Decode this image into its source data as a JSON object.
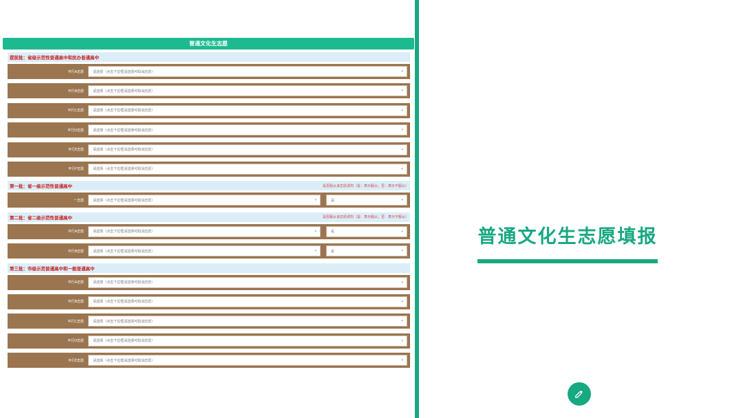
{
  "form": {
    "header": "普通文化生志愿",
    "placeholder": "请选择（点击下拉框请选择可取消志愿）",
    "yes_value": "是",
    "sections": [
      {
        "title": "提前批：省级示范性普通高中和民办普通高中",
        "note": "",
        "rows": [
          {
            "label": "平行A志愿",
            "has_yn": false
          },
          {
            "label": "平行B志愿",
            "has_yn": false
          },
          {
            "label": "平行C志愿",
            "has_yn": false
          },
          {
            "label": "平行D志愿",
            "has_yn": false
          },
          {
            "label": "平行E志愿",
            "has_yn": false
          },
          {
            "label": "平行F志愿",
            "has_yn": false
          }
        ]
      },
      {
        "title": "第一批：省一级示范性普通高中",
        "note": "是否服从该志愿调剂（是：表示服从；否：表示不服从）",
        "rows": [
          {
            "label": "一志愿",
            "has_yn": true
          }
        ]
      },
      {
        "title": "第二批：省二级示范性普通高中",
        "note": "是否服从该志愿调剂（是：表示服从；否：表示不服从）",
        "rows": [
          {
            "label": "平行A志愿",
            "has_yn": true
          },
          {
            "label": "平行B志愿",
            "has_yn": true
          }
        ]
      },
      {
        "title": "第三批：市级示范普通高中和一般普通高中",
        "note": "",
        "rows": [
          {
            "label": "平行A志愿",
            "has_yn": false
          },
          {
            "label": "平行B志愿",
            "has_yn": false
          },
          {
            "label": "平行C志愿",
            "has_yn": false
          },
          {
            "label": "平行D志愿",
            "has_yn": false
          },
          {
            "label": "平行E志愿",
            "has_yn": false
          }
        ]
      }
    ]
  },
  "title": "普通文化生志愿填报",
  "icons": {
    "edit": "pencil-icon",
    "caret": "chevron-down-icon"
  },
  "colors": {
    "accent": "#18a882",
    "header_green": "#1dba8f",
    "row_brown": "#9a7550",
    "section_bg": "#dbeef8",
    "section_title": "#c81a1a"
  }
}
